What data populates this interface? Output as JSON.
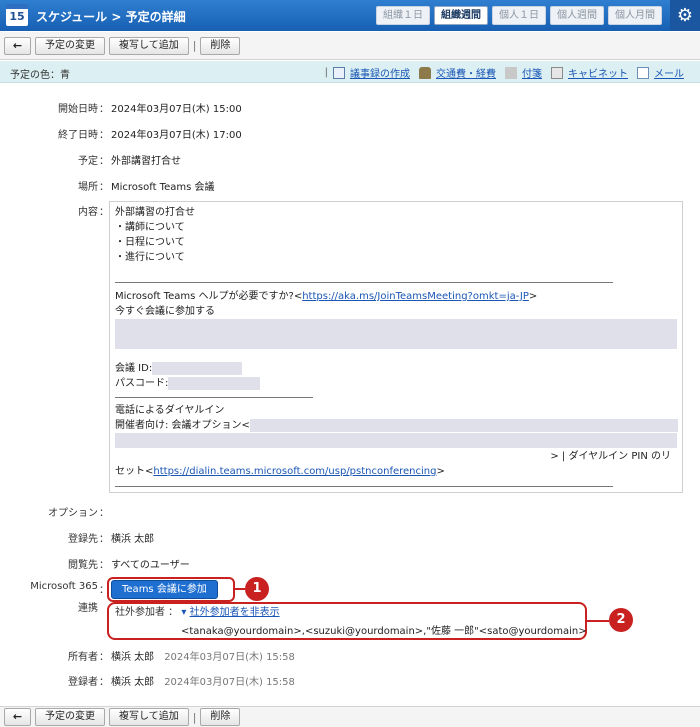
{
  "header": {
    "calendar_day": "15",
    "title": "スケジュール > 予定の詳細",
    "tabs": [
      "組織１日",
      "組織週間",
      "個人１日",
      "個人週間",
      "個人月間"
    ],
    "active_tab": "組織週間"
  },
  "toolbar": {
    "back_label": "←",
    "edit_label": "予定の変更",
    "copy_label": "複写して追加",
    "delete_label": "削除"
  },
  "color_bar": {
    "label": "予定の色：青",
    "links": [
      "議事録の作成",
      "交通費・経費",
      "付箋",
      "キャビネット",
      "メール"
    ]
  },
  "fields": {
    "start_label": "開始日時",
    "start_value": "2024年03月07日(木) 15:00",
    "end_label": "終了日時",
    "end_value": "2024年03月07日(木) 17:00",
    "plan_label": "予定",
    "plan_value": "外部講習打合せ",
    "place_label": "場所",
    "place_value": "Microsoft Teams 会議",
    "content_label": "内容",
    "option_label": "オプション",
    "registrant_label": "登録先",
    "registrant_value": "横浜 太郎",
    "viewer_label": "閲覧先",
    "viewer_value": "すべてのユーザー",
    "ms365_label": "Microsoft 365",
    "ms365_label2": "連携",
    "owner_label": "所有者",
    "owner_name": "横浜 太郎",
    "owner_time": "2024年03月07日(木) 15:58",
    "creator_label": "登録者",
    "creator_name": "横浜 太郎",
    "creator_time": "2024年03月07日(木) 15:58",
    "colon": "："
  },
  "content": {
    "line1": "外部講習の打合せ",
    "line2": "・講師について",
    "line3": "・日程について",
    "line4": "・進行について",
    "help_prefix": "Microsoft Teams ヘルプが必要ですか?<",
    "help_link": "https://aka.ms/JoinTeamsMeeting?omkt=ja-JP",
    "help_suffix": ">",
    "join_now": "今すぐ会議に参加する",
    "meeting_id": "会議 ID:",
    "passcode": "パスコード:",
    "dial_in": "電話によるダイヤルイン",
    "organizer": "開催者向け: 会議オプション<",
    "pin_suffix": "> | ダイヤルイン PIN のリ",
    "pin_prefix": "セット<",
    "pin_link": "https://dialin.teams.microsoft.com/usp/pstnconferencing",
    "pin_end": ">"
  },
  "teams": {
    "join_button": "Teams 会議に参加",
    "external_label": "社外参加者 ：",
    "toggle_link": "社外参加者を非表示",
    "emails": "<tanaka@yourdomain>,<suzuki@yourdomain>,\"佐藤 一郎\"<sato@yourdomain>",
    "badge1": "1",
    "badge2": "2"
  },
  "icons": {
    "gear": "gear-icon",
    "back": "back-arrow-icon",
    "toggle": "triangle-down-icon"
  },
  "colors": {
    "header": "#1760b4",
    "strip": "#dcf0f3",
    "link": "#1a56b5",
    "annotation": "#c92020",
    "teams_button": "#1f6fd1"
  }
}
